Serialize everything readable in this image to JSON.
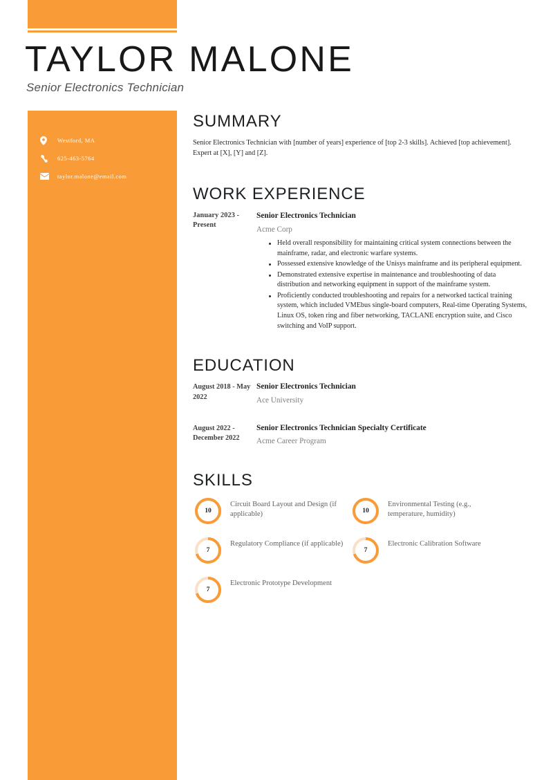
{
  "header": {
    "name": "TAYLOR MALONE",
    "job_title": "Senior Electronics Technician",
    "accent_color": "#f99b37",
    "accent_light_color": "#fbe0c8"
  },
  "sidebar": {
    "contacts": [
      {
        "icon": "location-pin-icon",
        "text": "Westford, MA"
      },
      {
        "icon": "phone-icon",
        "text": "625-463-5764"
      },
      {
        "icon": "envelope-icon",
        "text": "taylor.malone@email.com"
      }
    ]
  },
  "summary": {
    "title": "SUMMARY",
    "text": "Senior Electronics Technician with [number of years] experience of [top 2-3 skills]. Achieved [top achievement]. Expert at [X], [Y] and [Z]."
  },
  "work_experience": {
    "title": "WORK EXPERIENCE",
    "entries": [
      {
        "dates": "January 2023 - Present",
        "role": "Senior Electronics Technician",
        "organization": "Acme Corp",
        "bullets": [
          "Held overall responsibility for maintaining critical system connections between the mainframe, radar, and electronic warfare systems.",
          "Possessed extensive knowledge of the Unisys mainframe and its peripheral equipment.",
          "Demonstrated extensive expertise in maintenance and troubleshooting of data distribution and networking equipment in support of the mainframe system.",
          "Proficiently conducted troubleshooting and repairs for a networked tactical training system, which included VMEbus single-board computers, Real-time Operating Systems, Linux OS, token ring and fiber networking, TACLANE encryption suite, and Cisco switching and VoIP support."
        ]
      }
    ]
  },
  "education": {
    "title": "EDUCATION",
    "entries": [
      {
        "dates": "August 2018 - May 2022",
        "role": "Senior Electronics Technician",
        "organization": "Ace University"
      },
      {
        "dates": "August 2022 - December 2022",
        "role": "Senior Electronics Technician Specialty Certificate",
        "organization": "Acme Career Program"
      }
    ]
  },
  "skills": {
    "title": "SKILLS",
    "max_value": 10,
    "items": [
      {
        "value": "10",
        "percent": 100,
        "label": "Circuit Board Layout and Design (if applicable)"
      },
      {
        "value": "10",
        "percent": 100,
        "label": "Environmental Testing (e.g., temperature, humidity)"
      },
      {
        "value": "7",
        "percent": 70,
        "label": "Regulatory Compliance (if applicable)"
      },
      {
        "value": "7",
        "percent": 70,
        "label": "Electronic Calibration Software"
      },
      {
        "value": "7",
        "percent": 70,
        "label": "Electronic Prototype Development"
      }
    ]
  }
}
